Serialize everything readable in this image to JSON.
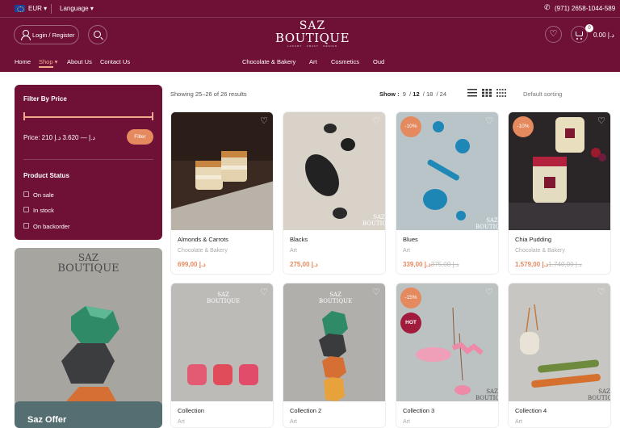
{
  "header": {
    "currency": "EUR",
    "language": "Language",
    "phone": "(971) 2658-1044-589",
    "login_label": "Login / Register",
    "logo": {
      "line1": "SAZ",
      "line2": "BOUTIQUE",
      "tagline": "LUXURY · CRAFT · DESIGN"
    },
    "cart_count": "0",
    "cart_total": "0.00 د.إ",
    "nav_left": [
      "Home",
      "Shop",
      "About Us",
      "Contact Us"
    ],
    "nav_center": [
      "Chocolate & Bakery",
      "Art",
      "Cosmetics",
      "Oud"
    ]
  },
  "filter": {
    "title": "Filter By Price",
    "price_text": "Price: 210 د.إ — 3.620 د.إ",
    "filter_button": "Filter",
    "status_title": "Product Status",
    "status_options": [
      "On sale",
      "In stock",
      "On backorder"
    ]
  },
  "promo": {
    "logo_line1": "SAZ",
    "logo_line2": "BOUTIQUE",
    "title": "Saz Offer"
  },
  "toolbar": {
    "results": "Showing 25–26 of 26 results",
    "show_label": "Show :",
    "show_options": [
      "9",
      "12",
      "18",
      "24"
    ],
    "show_selected": "12",
    "sorting": "Default sorting"
  },
  "products": [
    {
      "name": "Almonds & Carrots",
      "category": "Chocolate & Bakery",
      "price": "د.إ 699,00",
      "old_price": "",
      "badge": "",
      "hot": ""
    },
    {
      "name": "Blacks",
      "category": "Art",
      "price": "د.إ 275,00",
      "old_price": "",
      "badge": "",
      "hot": ""
    },
    {
      "name": "Blues",
      "category": "Art",
      "price": "د.إ 339,00",
      "old_price": "د.إ 375,00",
      "badge": "-10%",
      "hot": ""
    },
    {
      "name": "Chia Pudding",
      "category": "Chocolate & Bakery",
      "price": "د.إ 1.579,00",
      "old_price": "د.إ 1.740,00",
      "badge": "-10%",
      "hot": ""
    },
    {
      "name": "Collection",
      "category": "Art",
      "price": "",
      "old_price": "",
      "badge": "",
      "hot": ""
    },
    {
      "name": "Collection 2",
      "category": "Art",
      "price": "",
      "old_price": "",
      "badge": "",
      "hot": ""
    },
    {
      "name": "Collection 3",
      "category": "Art",
      "price": "",
      "old_price": "",
      "badge": "-15%",
      "hot": "HOT"
    },
    {
      "name": "Collection 4",
      "category": "Art",
      "price": "",
      "old_price": "",
      "badge": "",
      "hot": ""
    }
  ],
  "colors": {
    "brand": "#6f1037",
    "accent": "#e5895f"
  }
}
